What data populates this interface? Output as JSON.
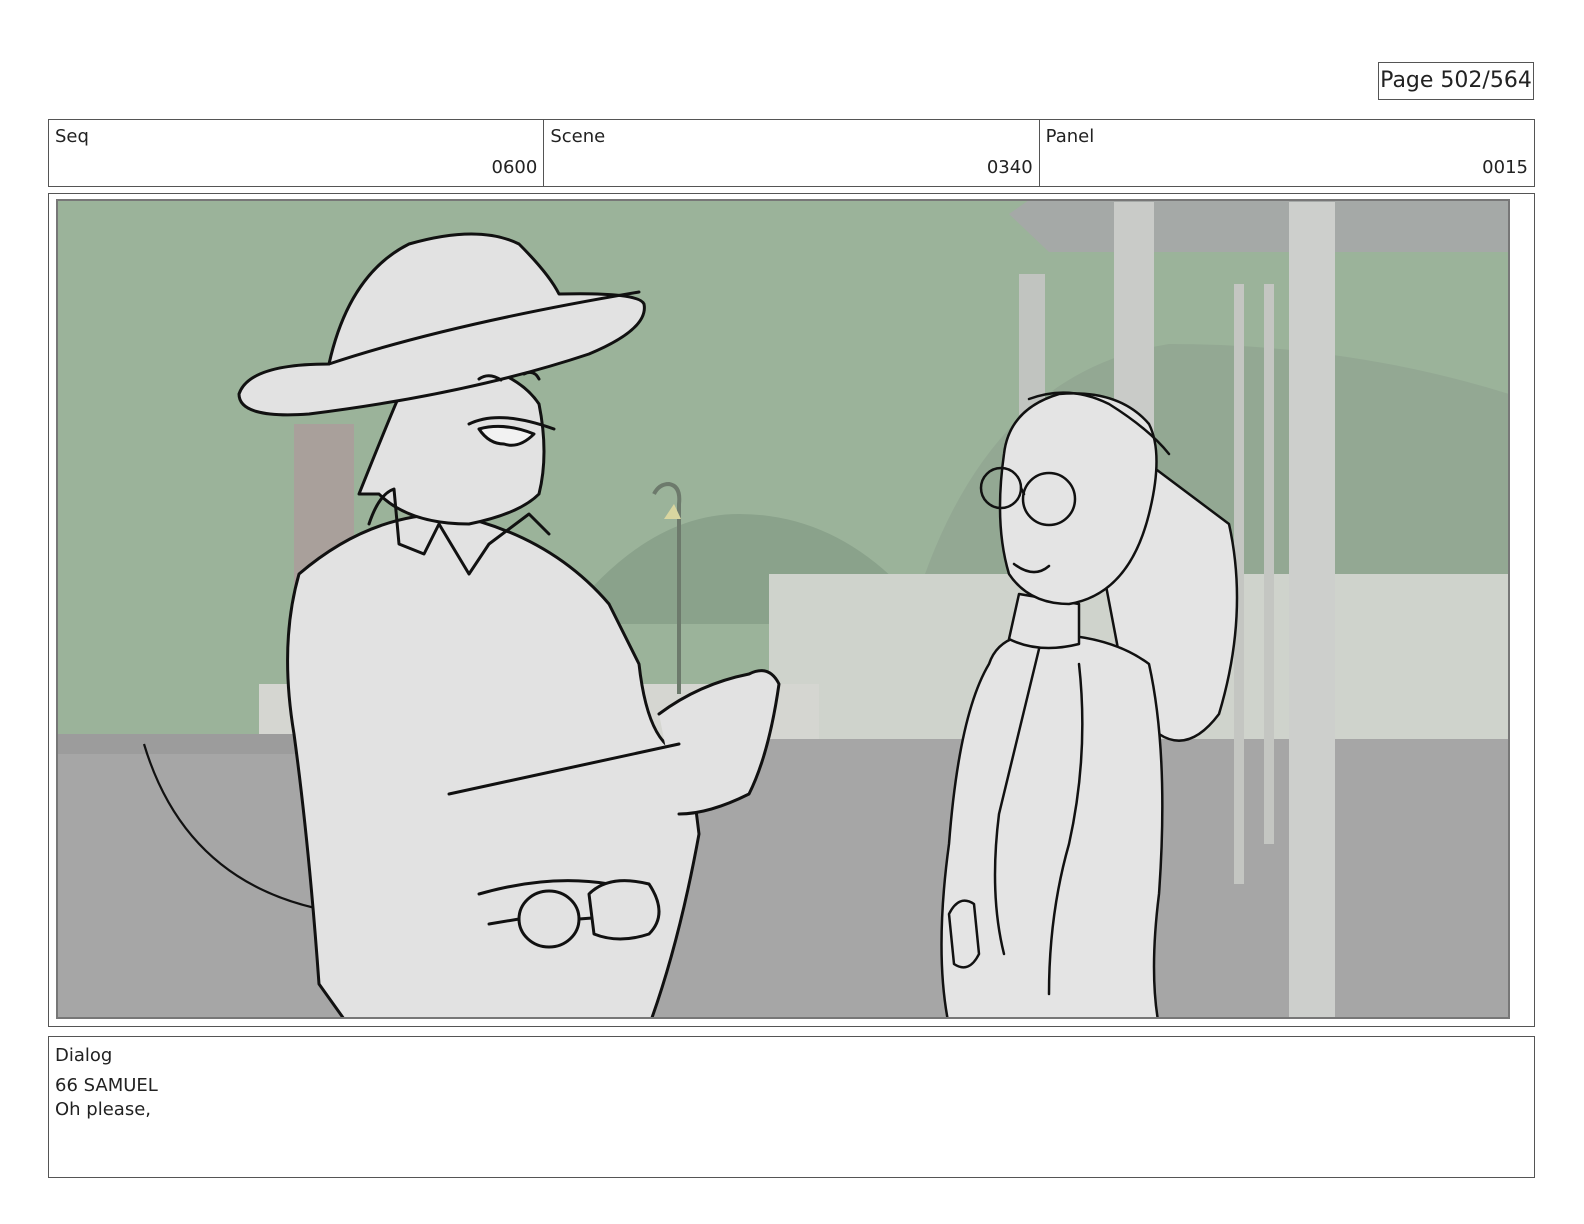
{
  "page": {
    "label": "Page 502/564"
  },
  "header": {
    "seq": {
      "label": "Seq",
      "value": "0600"
    },
    "scene": {
      "label": "Scene",
      "value": "0340"
    },
    "panel": {
      "label": "Panel",
      "value": "0015"
    }
  },
  "dialog": {
    "label": "Dialog",
    "lines": [
      "66 SAMUEL",
      "Oh please,"
    ]
  },
  "colors": {
    "sky_green": "#9bb39a",
    "ground_gray": "#a6a6a6",
    "line_ink": "#111111"
  }
}
